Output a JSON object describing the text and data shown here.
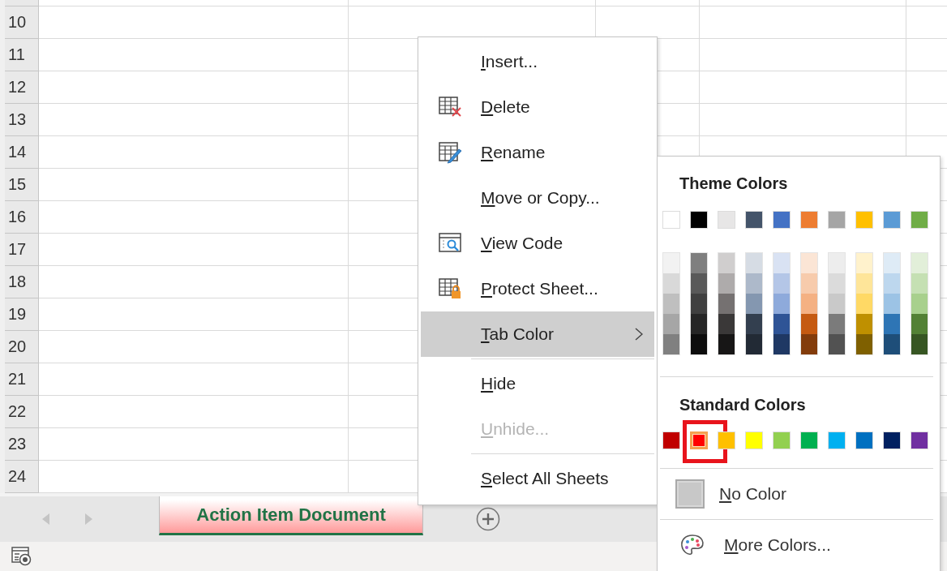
{
  "grid": {
    "rows": [
      "10",
      "11",
      "12",
      "13",
      "14",
      "15",
      "16",
      "17",
      "18",
      "19",
      "20",
      "21",
      "22",
      "23",
      "24"
    ]
  },
  "context_menu": {
    "items": [
      {
        "label": "Insert...",
        "kind": "plain",
        "disabled": false,
        "selected": false,
        "separator_before": false
      },
      {
        "label": "Delete",
        "kind": "delete",
        "disabled": false,
        "selected": false,
        "separator_before": false
      },
      {
        "label": "Rename",
        "kind": "rename",
        "disabled": false,
        "selected": false,
        "separator_before": false
      },
      {
        "label": "Move or Copy...",
        "kind": "plain",
        "disabled": false,
        "selected": false,
        "separator_before": false
      },
      {
        "label": "View Code",
        "kind": "view_code",
        "disabled": false,
        "selected": false,
        "separator_before": false
      },
      {
        "label": "Protect Sheet...",
        "kind": "protect",
        "disabled": false,
        "selected": false,
        "separator_before": false
      },
      {
        "label": "Tab Color",
        "kind": "submenu",
        "disabled": false,
        "selected": true,
        "separator_before": false
      },
      {
        "label": "Hide",
        "kind": "plain",
        "disabled": false,
        "selected": false,
        "separator_before": true
      },
      {
        "label": "Unhide...",
        "kind": "plain",
        "disabled": true,
        "selected": false,
        "separator_before": false
      },
      {
        "label": "Select All Sheets",
        "kind": "plain",
        "disabled": false,
        "selected": false,
        "separator_before": true
      }
    ]
  },
  "tab_color_menu": {
    "theme_label": "Theme Colors",
    "theme_colors": [
      {
        "color": "#ffffff",
        "shades": [
          {
            "color": "#f2f2f2"
          },
          {
            "color": "#d9d9d9"
          },
          {
            "color": "#bfbfbf"
          },
          {
            "color": "#a6a6a6"
          },
          {
            "color": "#808080"
          }
        ]
      },
      {
        "color": "#000000",
        "shades": [
          {
            "color": "#7f7f7f"
          },
          {
            "color": "#595959"
          },
          {
            "color": "#404040"
          },
          {
            "color": "#262626"
          },
          {
            "color": "#0d0d0d"
          }
        ]
      },
      {
        "color": "#e7e6e6",
        "shades": [
          {
            "color": "#d0cece"
          },
          {
            "color": "#aeabab"
          },
          {
            "color": "#757171"
          },
          {
            "color": "#3a3838"
          },
          {
            "color": "#171616"
          }
        ]
      },
      {
        "color": "#44546a",
        "shades": [
          {
            "color": "#d6dce4"
          },
          {
            "color": "#adb9ca"
          },
          {
            "color": "#8497b0"
          },
          {
            "color": "#333f4f"
          },
          {
            "color": "#222a35"
          }
        ]
      },
      {
        "color": "#4472c4",
        "shades": [
          {
            "color": "#d9e2f3"
          },
          {
            "color": "#b4c6e7"
          },
          {
            "color": "#8eaadb"
          },
          {
            "color": "#2f5496"
          },
          {
            "color": "#1f3864"
          }
        ]
      },
      {
        "color": "#ed7d31",
        "shades": [
          {
            "color": "#fbe5d5"
          },
          {
            "color": "#f7cbac"
          },
          {
            "color": "#f4b183"
          },
          {
            "color": "#c55a11"
          },
          {
            "color": "#833c0b"
          }
        ]
      },
      {
        "color": "#a5a5a5",
        "shades": [
          {
            "color": "#ededed"
          },
          {
            "color": "#dbdbdb"
          },
          {
            "color": "#c9c9c9"
          },
          {
            "color": "#7b7b7b"
          },
          {
            "color": "#525252"
          }
        ]
      },
      {
        "color": "#ffc000",
        "shades": [
          {
            "color": "#fff2cc"
          },
          {
            "color": "#fee599"
          },
          {
            "color": "#ffd965"
          },
          {
            "color": "#bf9000"
          },
          {
            "color": "#7f6000"
          }
        ]
      },
      {
        "color": "#5b9bd5",
        "shades": [
          {
            "color": "#deebf6"
          },
          {
            "color": "#bdd7ee"
          },
          {
            "color": "#9cc3e5"
          },
          {
            "color": "#2e75b5"
          },
          {
            "color": "#1e4e79"
          }
        ]
      },
      {
        "color": "#70ad47",
        "shades": [
          {
            "color": "#e2efd9"
          },
          {
            "color": "#c5e0b3"
          },
          {
            "color": "#a8d08d"
          },
          {
            "color": "#538135"
          },
          {
            "color": "#375623"
          }
        ]
      }
    ],
    "standard_label": "Standard Colors",
    "standard_colors": [
      {
        "color": "#c00000",
        "selected": false
      },
      {
        "color": "#ff0000",
        "selected": true
      },
      {
        "color": "#ffc000",
        "selected": false
      },
      {
        "color": "#ffff00",
        "selected": false
      },
      {
        "color": "#92d050",
        "selected": false
      },
      {
        "color": "#00b050",
        "selected": false
      },
      {
        "color": "#00b0f0",
        "selected": false
      },
      {
        "color": "#0070c0",
        "selected": false
      },
      {
        "color": "#002060",
        "selected": false
      },
      {
        "color": "#7030a0",
        "selected": false
      }
    ],
    "annotation": true,
    "no_color": {
      "label": "No Color"
    },
    "more_colors": {
      "label": "More Colors..."
    }
  },
  "sheet_tabs": [
    {
      "label": "Action Item Document",
      "selected": true
    }
  ]
}
